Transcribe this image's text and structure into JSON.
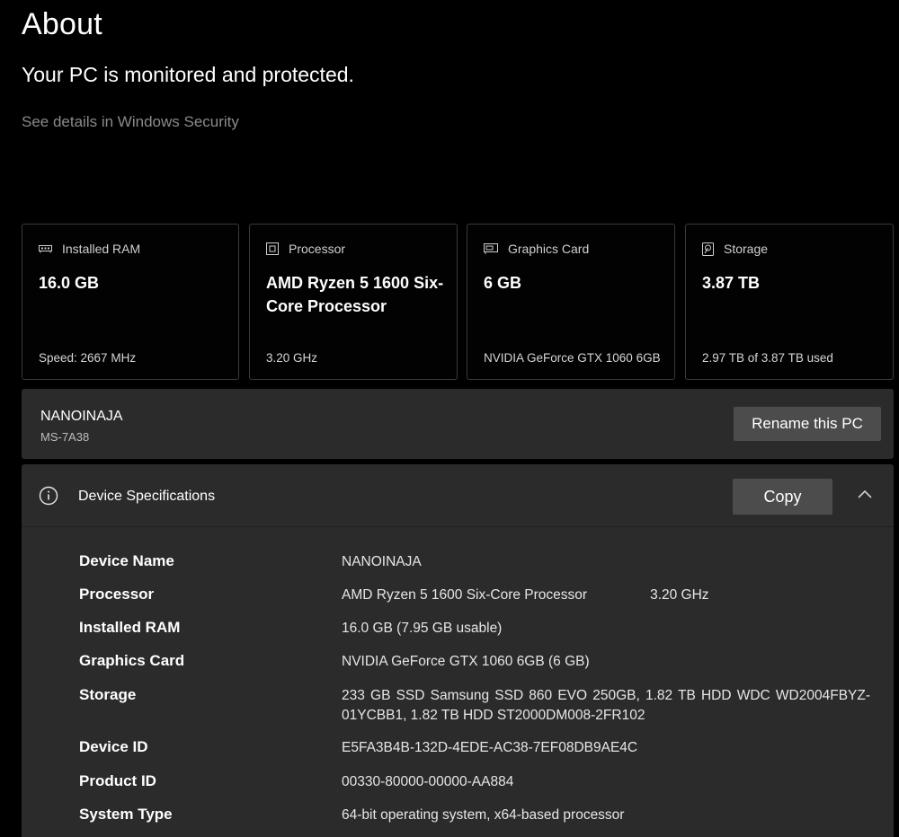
{
  "page": {
    "title": "About",
    "protection_status": "Your PC is monitored and protected.",
    "security_link": "See details in Windows Security"
  },
  "cards": [
    {
      "icon": "ram-icon",
      "label": "Installed RAM",
      "value": "16.0 GB",
      "sub": "Speed: 2667 MHz"
    },
    {
      "icon": "processor-icon",
      "label": "Processor",
      "value": "AMD Ryzen 5 1600 Six-Core Processor",
      "sub": "3.20 GHz"
    },
    {
      "icon": "graphics-card-icon",
      "label": "Graphics Card",
      "value": "6 GB",
      "sub": "NVIDIA GeForce GTX 1060 6GB"
    },
    {
      "icon": "storage-icon",
      "label": "Storage",
      "value": "3.87 TB",
      "sub": "2.97 TB of 3.87 TB used"
    }
  ],
  "pc": {
    "name": "NANOINAJA",
    "model": "MS-7A38",
    "rename_label": "Rename this PC"
  },
  "specs": {
    "header": "Device Specifications",
    "copy_label": "Copy",
    "rows": [
      {
        "key": "Device Name",
        "value": "NANOINAJA"
      },
      {
        "key": "Processor",
        "value": "AMD Ryzen 5 1600 Six-Core Processor",
        "extra": "3.20 GHz"
      },
      {
        "key": "Installed RAM",
        "value": "16.0 GB (7.95 GB usable)"
      },
      {
        "key": "Graphics Card",
        "value": "NVIDIA GeForce GTX 1060 6GB (6 GB)"
      },
      {
        "key": "Storage",
        "value": "233 GB SSD Samsung SSD 860 EVO 250GB, 1.82 TB HDD WDC WD2004FBYZ-01YCBB1, 1.82 TB HDD ST2000DM008-2FR102"
      },
      {
        "key": "Device ID",
        "value": "E5FA3B4B-132D-4EDE-AC38-7EF08DB9AE4C"
      },
      {
        "key": "Product ID",
        "value": "00330-80000-00000-AA884"
      },
      {
        "key": "System Type",
        "value": "64-bit operating system, x64-based processor"
      }
    ]
  },
  "colors": {
    "background": "#000000",
    "panel": "#2b2b2b",
    "button": "#4c4c4c",
    "muted_text": "#8a8a8a"
  }
}
